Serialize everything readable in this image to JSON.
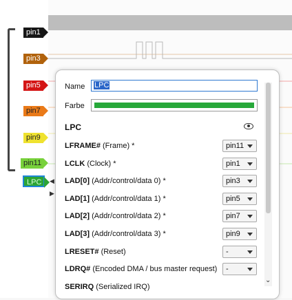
{
  "pins": [
    "pin1",
    "pin3",
    "pin5",
    "pin7",
    "pin9",
    "pin11"
  ],
  "bus_label": "LPC",
  "dialog": {
    "name_label": "Name",
    "name_value": "LPC",
    "color_label": "Farbe",
    "color_hex": "#27a83a",
    "section_title": "LPC",
    "rows": [
      {
        "name": "LFRAME#",
        "desc": " (Frame) *",
        "value": "pin11"
      },
      {
        "name": "LCLK",
        "desc": " (Clock) *",
        "value": "pin1"
      },
      {
        "name": "LAD[0]",
        "desc": " (Addr/control/data 0) *",
        "value": "pin3"
      },
      {
        "name": "LAD[1]",
        "desc": " (Addr/control/data 1) *",
        "value": "pin5"
      },
      {
        "name": "LAD[2]",
        "desc": " (Addr/control/data 2) *",
        "value": "pin7"
      },
      {
        "name": "LAD[3]",
        "desc": " (Addr/control/data 3) *",
        "value": "pin9"
      },
      {
        "name": "LRESET#",
        "desc": " (Reset)",
        "value": "-"
      },
      {
        "name": "LDRQ#",
        "desc": " (Encoded DMA / bus master request)",
        "value": "-"
      },
      {
        "name": "SERIRQ",
        "desc": " (Serialized IRQ)",
        "value": ""
      }
    ]
  },
  "colors": {
    "pin1": "#161616",
    "pin3": "#b1620c",
    "pin5": "#d41515",
    "pin7": "#ea7a18",
    "pin9": "#efe22f",
    "pin11": "#78d13b",
    "bus": "#2ca434"
  }
}
